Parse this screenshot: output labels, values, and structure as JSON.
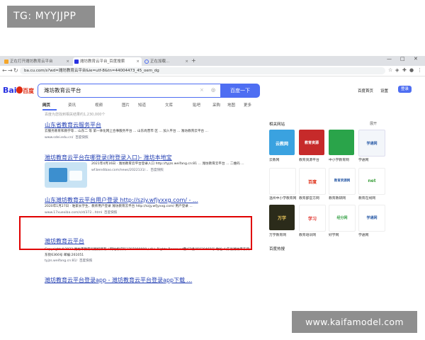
{
  "overlay_tag": "TG: MYYJJPP",
  "watermark": "www.kaifamodel.com",
  "browser": {
    "tabs": [
      {
        "label": "正在打开潍坊教育云平台",
        "active": false
      },
      {
        "label": "潍坊教育云平台_百度搜索",
        "active": true
      },
      {
        "label": "正在加载...",
        "active": false
      }
    ],
    "url": "ba.cu.com/s?wd=潍坊教育云平台&ie=utf-8&tn=44004473_45_oem_dg",
    "new_tab": "+",
    "win_min": "—",
    "win_max": "□",
    "win_close": "✕"
  },
  "baidu": {
    "logo_text": "Bai",
    "logo_du": "百度",
    "query": "潍坊教育云平台",
    "search_button": "百度一下",
    "top_links": [
      "百度首页",
      "设置"
    ],
    "login": "登录",
    "tabs": [
      "网页",
      "资讯",
      "视频",
      "图片",
      "知道",
      "文库",
      "贴吧",
      "采购",
      "地图",
      "更多"
    ],
    "result_count": "百度为您找到相关结果约1,230,000个"
  },
  "results": [
    {
      "title": "山东省教育云服务平台",
      "snippet": "云服务教育和教学等... 山东二 等 第一体化网上合事服务平台 ... 山东尚营市 区 ... 加入平台 ... 潍坊教育云平台 ...",
      "site": "www.sdei.edu.cn/",
      "snapshot": "百度快照"
    },
    {
      "title": "潍坊教育云平台在哪登录(附登录入口)- 潍坊本地宝",
      "snippet": "2021年4月16日 · 潍坊教育云平台登录入口 http://tyjzs.weifang.cn:81 ... 潍坊教育云平台 ... 二维码 ...",
      "site": "wf.bendibao.com/news/2022131/...",
      "snapshot": "百度快照"
    },
    {
      "title": "山东潍坊教育云平台用户登录 http://szjy.wfjyxxg.com/ - ...",
      "snippet": "2020年1月27日 · 谁家长学生、教师用户登录 潍坊教育云平台 http://szjy.wfjyxxg.com/ 用户登录 ...",
      "site": "www.17xuexiba.com/s/d/372...html",
      "snapshot": "百度快照"
    },
    {
      "title": "潍坊教育云平台",
      "snippet": "Copyright ©2022 潍坊市教育局版权所有 / 网站标识码3707000080 / ALL Rights Reserved鲁ICP备05029468号 地址:山东省潍坊市东风东街6366号 邮编:261051",
      "site": "tyjzs.weifang.cn:81/",
      "snapshot": "百度快照"
    },
    {
      "title": "潍坊教育云平台登录app - 潍坊教育云平台登录app下载 ...",
      "snippet": "",
      "site": "",
      "snapshot": ""
    }
  ],
  "sidebar": {
    "heading": "相关网站",
    "more": "展开",
    "tiles": [
      {
        "label": "云教网",
        "tile_text": "云教网"
      },
      {
        "label": "教育资源平台",
        "tile_text": "教育资源"
      },
      {
        "label": "中小学教育网",
        "tile_text": ""
      },
      {
        "label": "学通网",
        "tile_text": "学通网"
      },
      {
        "label": "温州中小学教育网",
        "tile_text": ""
      },
      {
        "label": "教育部官方网",
        "tile_text": "百度"
      },
      {
        "label": "教育教研网",
        "tile_text": "教育资源网"
      },
      {
        "label": "教育在线网",
        "tile_text": "net"
      },
      {
        "label": "万学教育网",
        "tile_text": "万学"
      },
      {
        "label": "教育培训网",
        "tile_text": "学习"
      },
      {
        "label": "好学网",
        "tile_text": "经分网"
      },
      {
        "label": "学通网",
        "tile_text": "学通网"
      }
    ],
    "hot_heading": "百度热搜"
  }
}
